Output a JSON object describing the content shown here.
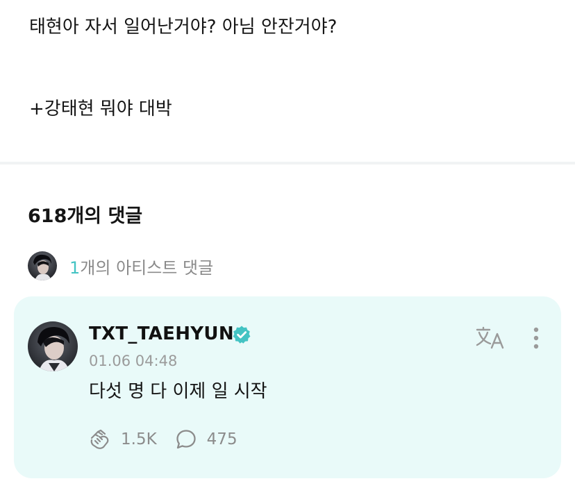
{
  "post": {
    "line1": "태현아 자서 일어난거야? 아님 안잔거야?",
    "line2": "+강태현 뭐야 대박"
  },
  "comments": {
    "count_label": "618개의 댓글",
    "artist_count_number": "1",
    "artist_count_suffix": "개의 아티스트 댓글"
  },
  "artist_comment": {
    "author": "TXT_TAEHYUN",
    "verified": true,
    "timestamp": "01.06 04:48",
    "text": "다섯 명 다 이제 일 시작",
    "likes": "1.5K",
    "replies": "475"
  },
  "icons": {
    "translate": "translate-icon",
    "more": "more-vertical-icon",
    "like": "like-hand-icon",
    "reply": "reply-bubble-icon",
    "verified": "verified-badge-icon"
  },
  "colors": {
    "accent": "#43c3c3",
    "card_background": "#e9faf9",
    "muted_text": "#9b9b9b"
  }
}
